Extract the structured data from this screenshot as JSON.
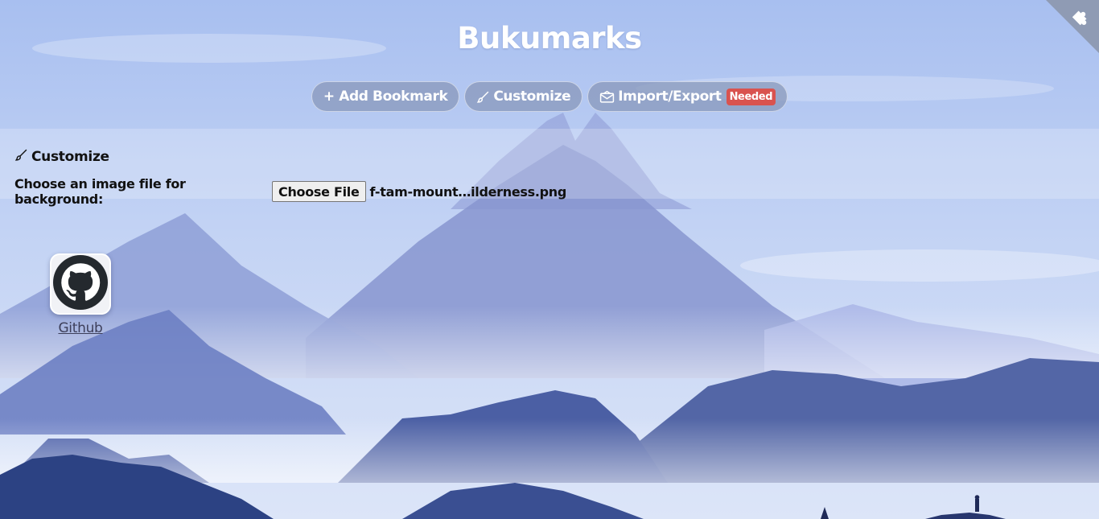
{
  "app": {
    "title": "Bukumarks"
  },
  "nav": {
    "add_bookmark": "+ Add Bookmark",
    "customize": "Customize",
    "import_export": "Import/Export",
    "import_badge": "Needed"
  },
  "customize_panel": {
    "heading": "Customize",
    "file_label": "Choose an image file for background:",
    "file_button": "Choose File",
    "file_name": "f-tam-mount…ilderness.png"
  },
  "bookmarks": [
    {
      "label": "Github",
      "icon": "github-icon"
    }
  ],
  "colors": {
    "sky_top": "#a9c0ef",
    "mountain_dark": "#2c4283",
    "badge": "#d9534f"
  },
  "icons": {
    "customize": "brush-icon",
    "import_export": "envelope-icon",
    "corner": "puzzle-icon"
  }
}
